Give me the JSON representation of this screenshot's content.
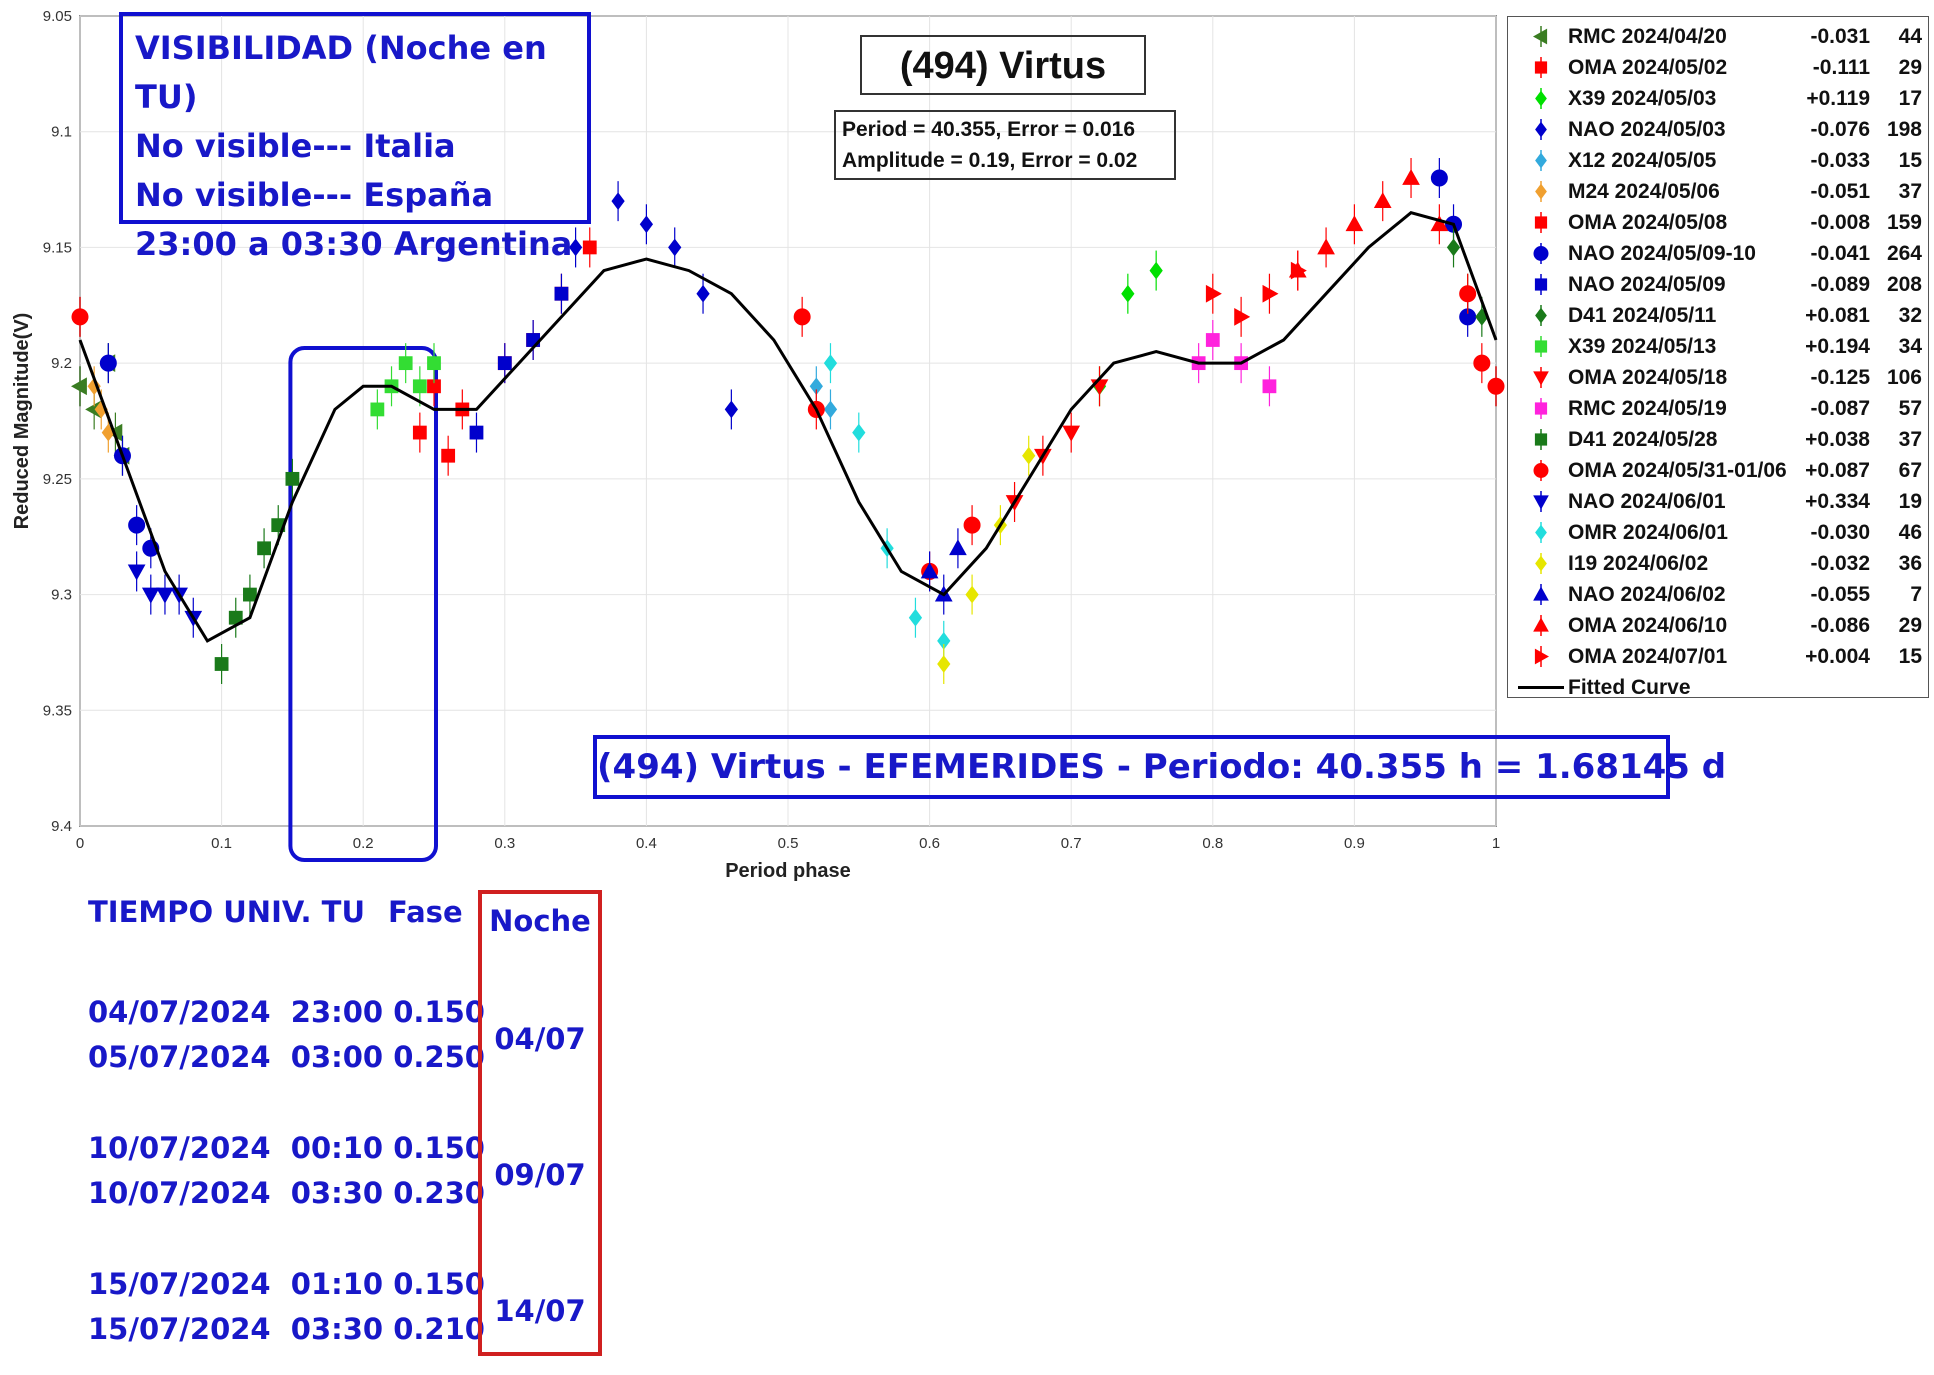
{
  "chart_data": {
    "type": "scatter",
    "title": "(494) Virtus",
    "xlabel": "Period phase",
    "ylabel": "Reduced Magnitude(V)",
    "xlim": [
      0,
      1
    ],
    "ylim": [
      9.05,
      9.4
    ],
    "y_inverted": true,
    "grid": true,
    "x_ticks": [
      "0",
      "0.1",
      "0.2",
      "0.3",
      "0.4",
      "0.5",
      "0.6",
      "0.7",
      "0.8",
      "0.9",
      "1"
    ],
    "y_ticks": [
      "9.05",
      "9.1",
      "9.15",
      "9.2",
      "9.25",
      "9.3",
      "9.35",
      "9.4"
    ],
    "fit_stats": [
      "Period =  40.355, Error = 0.016",
      "Amplitude = 0.19, Error = 0.02"
    ],
    "legend_position": "top-right",
    "series": [
      {
        "name": "RMC 2024/04/20",
        "offset": "-0.031",
        "count": "44",
        "color": "#3a7d22",
        "marker": "triangle-left",
        "x": [
          0.0,
          0.01,
          0.02,
          0.025,
          0.03
        ],
        "y": [
          9.21,
          9.22,
          9.2,
          9.23,
          9.24
        ]
      },
      {
        "name": "OMA 2024/05/02",
        "offset": "-0.111",
        "count": "29",
        "color": "#ff0000",
        "marker": "square",
        "x": [
          0.24,
          0.25,
          0.26,
          0.27
        ],
        "y": [
          9.23,
          9.21,
          9.24,
          9.22
        ]
      },
      {
        "name": "X39 2024/05/03",
        "offset": "+0.119",
        "count": "17",
        "color": "#00e000",
        "marker": "diamond",
        "x": [
          0.72,
          0.74,
          0.76
        ],
        "y": [
          9.21,
          9.17,
          9.16
        ]
      },
      {
        "name": "NAO 2024/05/03",
        "offset": "-0.076",
        "count": "198",
        "color": "#0000cc",
        "marker": "diamond",
        "x": [
          0.35,
          0.38,
          0.4,
          0.42,
          0.44,
          0.46
        ],
        "y": [
          9.15,
          9.13,
          9.14,
          9.15,
          9.17,
          9.22
        ]
      },
      {
        "name": "X12 2024/05/05",
        "offset": "-0.033",
        "count": "15",
        "color": "#33aadd",
        "marker": "diamond",
        "x": [
          0.52,
          0.53
        ],
        "y": [
          9.21,
          9.22
        ]
      },
      {
        "name": "M24 2024/05/06",
        "offset": "-0.051",
        "count": "37",
        "color": "#f0a030",
        "marker": "diamond",
        "x": [
          0.01,
          0.015,
          0.02
        ],
        "y": [
          9.21,
          9.22,
          9.23
        ]
      },
      {
        "name": "OMA 2024/05/08",
        "offset": "-0.008",
        "count": "159",
        "color": "#ff0000",
        "marker": "square",
        "x": [
          0.3,
          0.32,
          0.34,
          0.36
        ],
        "y": [
          9.2,
          9.19,
          9.17,
          9.15
        ]
      },
      {
        "name": "NAO 2024/05/09-10",
        "offset": "-0.041",
        "count": "264",
        "color": "#0000cc",
        "marker": "circle",
        "x": [
          0.02,
          0.03,
          0.04,
          0.05,
          0.96,
          0.97,
          0.98
        ],
        "y": [
          9.2,
          9.24,
          9.27,
          9.28,
          9.12,
          9.14,
          9.18
        ]
      },
      {
        "name": "NAO 2024/05/09",
        "offset": "-0.089",
        "count": "208",
        "color": "#0000cc",
        "marker": "square",
        "x": [
          0.28,
          0.3,
          0.32,
          0.34
        ],
        "y": [
          9.23,
          9.2,
          9.19,
          9.17
        ]
      },
      {
        "name": "D41 2024/05/11",
        "offset": "+0.081",
        "count": "32",
        "color": "#1a7a1a",
        "marker": "diamond",
        "x": [
          0.97,
          0.98,
          0.99
        ],
        "y": [
          9.15,
          9.17,
          9.18
        ]
      },
      {
        "name": "X39 2024/05/13",
        "offset": "+0.194",
        "count": "34",
        "color": "#33dd33",
        "marker": "square",
        "x": [
          0.21,
          0.22,
          0.23,
          0.24,
          0.25
        ],
        "y": [
          9.22,
          9.21,
          9.2,
          9.21,
          9.2
        ]
      },
      {
        "name": "OMA 2024/05/18",
        "offset": "-0.125",
        "count": "106",
        "color": "#ff0000",
        "marker": "triangle-down",
        "x": [
          0.66,
          0.68,
          0.7,
          0.72
        ],
        "y": [
          9.26,
          9.24,
          9.23,
          9.21
        ]
      },
      {
        "name": "RMC 2024/05/19",
        "offset": "-0.087",
        "count": "57",
        "color": "#ff22dd",
        "marker": "square",
        "x": [
          0.79,
          0.8,
          0.82,
          0.84
        ],
        "y": [
          9.2,
          9.19,
          9.2,
          9.21
        ]
      },
      {
        "name": "D41 2024/05/28",
        "offset": "+0.038",
        "count": "37",
        "color": "#1a7a1a",
        "marker": "square",
        "x": [
          0.1,
          0.11,
          0.12,
          0.13,
          0.14,
          0.15
        ],
        "y": [
          9.33,
          9.31,
          9.3,
          9.28,
          9.27,
          9.25
        ]
      },
      {
        "name": "OMA 2024/05/31-01/06",
        "offset": "+0.087",
        "count": "67",
        "color": "#ff0000",
        "marker": "circle",
        "x": [
          0.0,
          0.51,
          0.52,
          0.6,
          0.63,
          0.98,
          0.99,
          1.0
        ],
        "y": [
          9.18,
          9.18,
          9.22,
          9.29,
          9.27,
          9.17,
          9.2,
          9.21
        ]
      },
      {
        "name": "NAO 2024/06/01",
        "offset": "+0.334",
        "count": "19",
        "color": "#0000cc",
        "marker": "triangle-down",
        "x": [
          0.04,
          0.05,
          0.06,
          0.07,
          0.08
        ],
        "y": [
          9.29,
          9.3,
          9.3,
          9.3,
          9.31
        ]
      },
      {
        "name": "OMR 2024/06/01",
        "offset": "-0.030",
        "count": "46",
        "color": "#22dddd",
        "marker": "diamond",
        "x": [
          0.53,
          0.55,
          0.57,
          0.59,
          0.61
        ],
        "y": [
          9.2,
          9.23,
          9.28,
          9.31,
          9.32
        ]
      },
      {
        "name": "I19 2024/06/02",
        "offset": "-0.032",
        "count": "36",
        "color": "#e6e600",
        "marker": "diamond",
        "x": [
          0.61,
          0.63,
          0.65,
          0.67
        ],
        "y": [
          9.33,
          9.3,
          9.27,
          9.24
        ]
      },
      {
        "name": "NAO 2024/06/02",
        "offset": "-0.055",
        "count": "7",
        "color": "#0000cc",
        "marker": "triangle-up",
        "x": [
          0.6,
          0.61,
          0.62
        ],
        "y": [
          9.29,
          9.3,
          9.28
        ]
      },
      {
        "name": "OMA 2024/06/10",
        "offset": "-0.086",
        "count": "29",
        "color": "#ff0000",
        "marker": "triangle-up",
        "x": [
          0.86,
          0.88,
          0.9,
          0.92,
          0.94,
          0.96
        ],
        "y": [
          9.16,
          9.15,
          9.14,
          9.13,
          9.12,
          9.14
        ]
      },
      {
        "name": "OMA 2024/07/01",
        "offset": "+0.004",
        "count": "15",
        "color": "#ff0000",
        "marker": "triangle-right",
        "x": [
          0.8,
          0.82,
          0.84,
          0.86
        ],
        "y": [
          9.17,
          9.18,
          9.17,
          9.16
        ]
      }
    ],
    "fit_curve": {
      "name": "Fitted Curve",
      "x": [
        0,
        0.03,
        0.06,
        0.09,
        0.12,
        0.15,
        0.18,
        0.2,
        0.22,
        0.25,
        0.28,
        0.31,
        0.34,
        0.37,
        0.4,
        0.43,
        0.46,
        0.49,
        0.52,
        0.55,
        0.58,
        0.61,
        0.64,
        0.67,
        0.7,
        0.73,
        0.76,
        0.79,
        0.82,
        0.85,
        0.88,
        0.91,
        0.94,
        0.97,
        1.0
      ],
      "y": [
        9.19,
        9.24,
        9.29,
        9.32,
        9.31,
        9.26,
        9.22,
        9.21,
        9.21,
        9.22,
        9.22,
        9.2,
        9.18,
        9.16,
        9.155,
        9.16,
        9.17,
        9.19,
        9.22,
        9.26,
        9.29,
        9.3,
        9.28,
        9.25,
        9.22,
        9.2,
        9.195,
        9.2,
        9.2,
        9.19,
        9.17,
        9.15,
        9.135,
        9.14,
        9.19
      ]
    },
    "highlight_range_x": [
      0.15,
      0.25
    ]
  },
  "visibility": {
    "lines": [
      "VISIBILIDAD (Noche en TU)",
      "No visible--- Italia",
      "No visible--- España",
      "23:00 a 03:30 Argentina"
    ]
  },
  "ephemeris_title": "(494) Virtus - EFEMERIDES - Periodo: 40.355 h = 1.68145 d",
  "ephemeris": {
    "header": {
      "time": "TIEMPO UNIV. TU",
      "phase": "Fase",
      "night": "Noche"
    },
    "groups": [
      {
        "night": "04/07",
        "rows": [
          [
            "04/07/2024",
            "23:00",
            "0.150"
          ],
          [
            "05/07/2024",
            "03:00",
            "0.250"
          ]
        ]
      },
      {
        "night": "09/07",
        "rows": [
          [
            "10/07/2024",
            "00:10",
            "0.150"
          ],
          [
            "10/07/2024",
            "03:30",
            "0.230"
          ]
        ]
      },
      {
        "night": "14/07",
        "rows": [
          [
            "15/07/2024",
            "01:10",
            "0.150"
          ],
          [
            "15/07/2024",
            "03:30",
            "0.210"
          ]
        ]
      }
    ]
  }
}
